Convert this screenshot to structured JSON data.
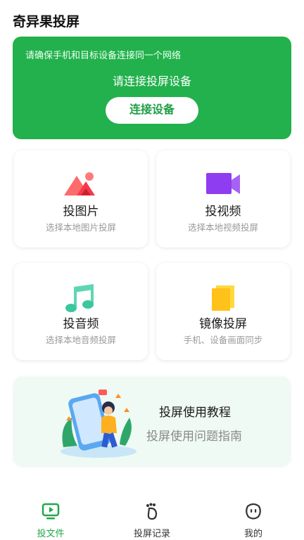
{
  "app": {
    "title": "奇异果投屏"
  },
  "connect": {
    "hint": "请确保手机和目标设备连接同一个网络",
    "prompt": "请连接投屏设备",
    "button_label": "连接设备"
  },
  "tiles": [
    {
      "title": "投图片",
      "subtitle": "选择本地图片投屏",
      "icon": "picture-icon"
    },
    {
      "title": "投视频",
      "subtitle": "选择本地视频投屏",
      "icon": "video-icon"
    },
    {
      "title": "投音频",
      "subtitle": "选择本地音频投屏",
      "icon": "music-icon"
    },
    {
      "title": "镜像投屏",
      "subtitle": "手机、设备画面同步",
      "icon": "mirror-icon"
    }
  ],
  "tutorial": {
    "title": "投屏使用教程",
    "subtitle": "投屏使用问题指南"
  },
  "tabs": [
    {
      "label": "投文件",
      "icon": "tv-icon",
      "active": true
    },
    {
      "label": "投屏记录",
      "icon": "footprint-icon",
      "active": false
    },
    {
      "label": "我的",
      "icon": "profile-face-icon",
      "active": false
    }
  ],
  "colors": {
    "accent": "#22b14c",
    "accent_text": "#1f9e45",
    "tab_active": "#22a74a"
  }
}
